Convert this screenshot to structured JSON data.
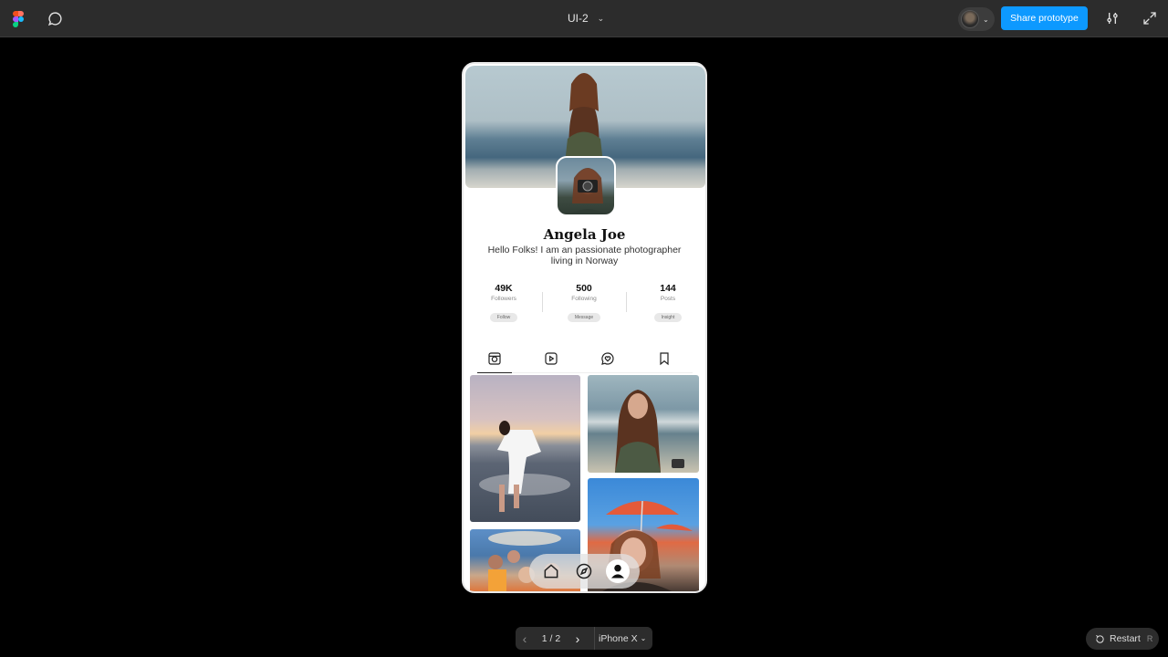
{
  "toolbar": {
    "file_name": "UI-2",
    "share_label": "Share prototype"
  },
  "profile": {
    "name": "Angela Joe",
    "bio": "Hello Folks! I am an passionate photographer living in Norway",
    "stats": [
      {
        "value": "49K",
        "label": "Followers",
        "button": "Follow"
      },
      {
        "value": "500",
        "label": "Following",
        "button": "Message"
      },
      {
        "value": "144",
        "label": "Posts",
        "button": "Insight"
      }
    ],
    "tabs": [
      {
        "icon": "photo-icon",
        "active": true
      },
      {
        "icon": "video-icon",
        "active": false
      },
      {
        "icon": "chat-heart-icon",
        "active": false
      },
      {
        "icon": "bookmark-icon",
        "active": false
      }
    ],
    "bottom_nav": [
      {
        "icon": "home-icon",
        "active": false
      },
      {
        "icon": "compass-icon",
        "active": false
      },
      {
        "icon": "profile-icon",
        "active": true
      }
    ]
  },
  "pager": {
    "current": "1",
    "total": "2",
    "device": "iPhone X"
  },
  "restart": {
    "label": "Restart",
    "shortcut": "R"
  },
  "colors": {
    "toolbar_bg": "#2c2c2c",
    "accent": "#0d99ff",
    "canvas_bg": "#000000"
  }
}
